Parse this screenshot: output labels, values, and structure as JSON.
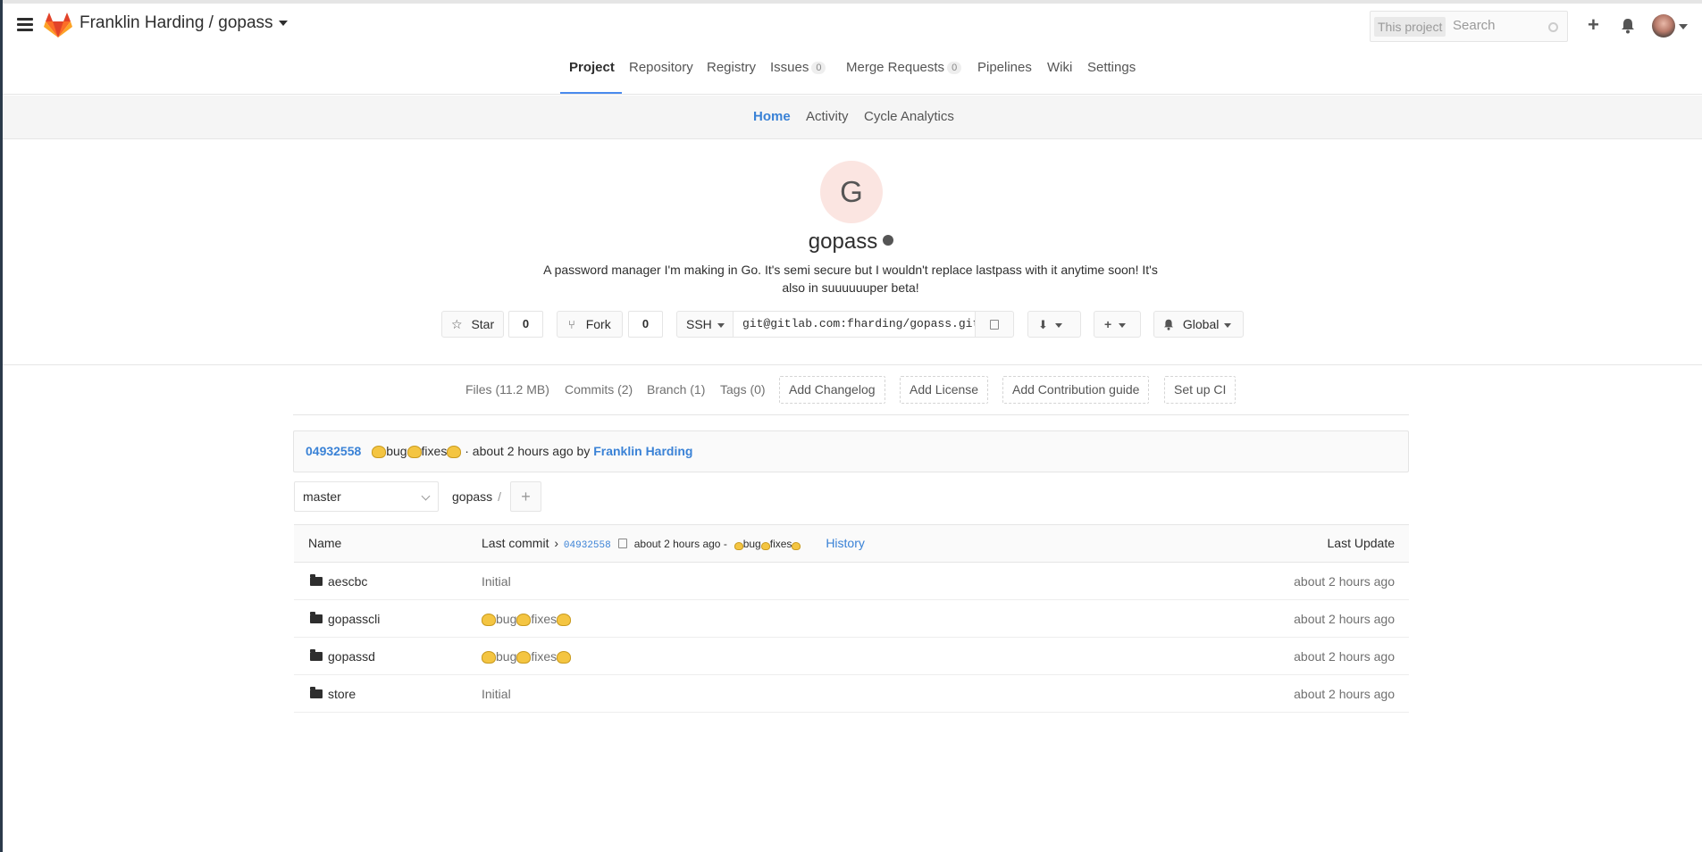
{
  "header": {
    "title_owner": "Franklin Harding",
    "title_sep": " / ",
    "title_project": "gopass",
    "search_scope": "This project",
    "search_placeholder": "Search"
  },
  "main_nav": [
    {
      "label": "Project",
      "active": true
    },
    {
      "label": "Repository"
    },
    {
      "label": "Registry"
    },
    {
      "label": "Issues",
      "count": "0"
    },
    {
      "label": "Merge Requests",
      "count": "0"
    },
    {
      "label": "Pipelines"
    },
    {
      "label": "Wiki"
    },
    {
      "label": "Settings"
    }
  ],
  "sub_nav": [
    {
      "label": "Home",
      "active": true
    },
    {
      "label": "Activity"
    },
    {
      "label": "Cycle Analytics"
    }
  ],
  "project": {
    "avatar_letter": "G",
    "name": "gopass",
    "description": "A password manager I'm making in Go. It's semi secure but I wouldn't replace lastpass with it anytime soon! It's also in suuuuuuper beta!",
    "star_label": "Star",
    "star_count": "0",
    "fork_label": "Fork",
    "fork_count": "0",
    "protocol": "SSH",
    "clone_url": "git@gitlab.com:fharding/gopass.git",
    "notification_label": "Global"
  },
  "stats": {
    "files": "Files (11.2 MB)",
    "commits": "Commits (2)",
    "branch": "Branch (1)",
    "tags": "Tags (0)",
    "add_changelog": "Add Changelog",
    "add_license": "Add License",
    "add_contrib": "Add Contribution guide",
    "setup_ci": "Set up CI"
  },
  "last_commit": {
    "sha": "04932558",
    "msg_word1": "bug",
    "msg_word2": "fixes",
    "meta": " · about 2 hours ago by ",
    "author": "Franklin Harding"
  },
  "branch": {
    "selected": "master",
    "crumb": "gopass",
    "crumb_sep": "/",
    "add": "+"
  },
  "tree": {
    "col_name": "Name",
    "col_last_commit": "Last commit",
    "lc_sha": "04932558",
    "lc_time": "about 2 hours ago -",
    "lc_word1": "bug",
    "lc_word2": "fixes",
    "history": "History",
    "col_last_update": "Last Update",
    "rows": [
      {
        "name": "aescbc",
        "message": "Initial",
        "updated": "about 2 hours ago"
      },
      {
        "name": "gopasscli",
        "msg_word1": "bug",
        "msg_word2": "fixes",
        "updated": "about 2 hours ago"
      },
      {
        "name": "gopassd",
        "msg_word1": "bug",
        "msg_word2": "fixes",
        "updated": "about 2 hours ago"
      },
      {
        "name": "store",
        "message": "Initial",
        "updated": "about 2 hours ago"
      }
    ]
  },
  "colors": {
    "link": "#3a82d6",
    "nav_underline": "#4a8bee",
    "avatar_bg": "#fbe5e1"
  }
}
